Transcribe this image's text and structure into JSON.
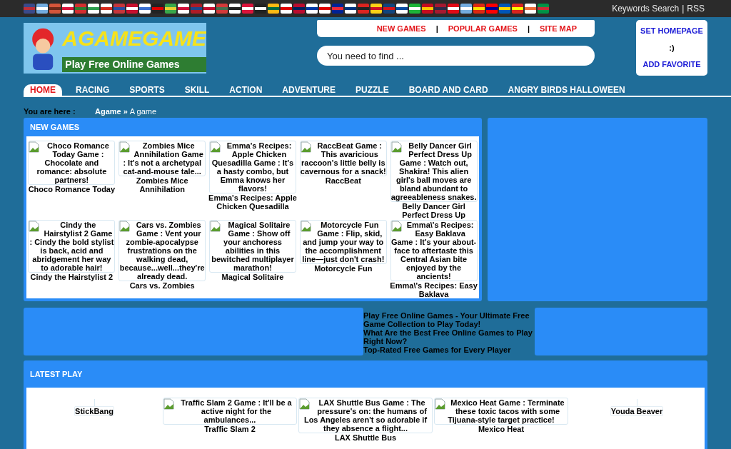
{
  "top_bar": {
    "links": [
      "Keywords Search",
      "RSS"
    ],
    "separator": "|"
  },
  "logo": {
    "name": "AGAMEGAME",
    "tagline": "Play Free Online Games"
  },
  "nav_links": {
    "items": [
      "NEW GAMES",
      "POPULAR GAMES",
      "SITE MAP"
    ],
    "separator": "|"
  },
  "search": {
    "placeholder": "You need to find ..."
  },
  "side_box": [
    {
      "kind": "link",
      "text": "SET HOMEPAGE"
    },
    {
      "kind": "text",
      "text": ":)"
    },
    {
      "kind": "link",
      "text": "ADD FAVORITE"
    }
  ],
  "menu": [
    {
      "label": "HOME",
      "selected": true
    },
    {
      "label": "RACING",
      "selected": false
    },
    {
      "label": "SPORTS",
      "selected": false
    },
    {
      "label": "SKILL",
      "selected": false
    },
    {
      "label": "ACTION",
      "selected": false
    },
    {
      "label": "ADVENTURE",
      "selected": false
    },
    {
      "label": "PUZZLE",
      "selected": false
    },
    {
      "label": "BOARD AND CARD",
      "selected": false
    },
    {
      "label": "ANGRY BIRDS HALLOWEEN",
      "selected": false
    }
  ],
  "breadcrumb": {
    "label": "You are here :",
    "items": [
      "Agame",
      "A game"
    ],
    "separator": "»"
  },
  "new_games": {
    "title": "NEW GAMES",
    "games": [
      {
        "alt": "Choco Romance Today Game : Chocolate and romance: absolute partners!",
        "title": "Choco Romance Today"
      },
      {
        "alt": "Zombies Mice Annihilation Game : It's not a archetypal cat-and-mouse tale...",
        "title": "Zombies Mice Annihilation"
      },
      {
        "alt": "Emma's Recipes: Apple Chicken Quesadilla Game : It's a hasty combo, but Emma knows her flavors!",
        "title": "Emma's Recipes: Apple Chicken Quesadilla"
      },
      {
        "alt": "RaccBeat Game : This avaricious raccoon's little belly is cavernous for a snack!",
        "title": "RaccBeat"
      },
      {
        "alt": "Belly Dancer Girl Perfect Dress Up Game : Watch out, Shakira! This alien girl's ball moves are bland abundant to agreeableness snakes.",
        "title": "Belly Dancer Girl Perfect Dress Up"
      },
      {
        "alt": "Cindy the Hairstylist 2 Game : Cindy the bold stylist is back, acid and abridgement her way to adorable hair!",
        "title": "Cindy the Hairstylist 2"
      },
      {
        "alt": "Cars vs. Zombies Game : Vent your zombie-apocalypse frustrations on the walking dead, because...well...they're already dead.",
        "title": "Cars vs. Zombies"
      },
      {
        "alt": "Magical Solitaire Game : Show off your anchoress abilities in this bewitched multiplayer marathon!",
        "title": "Magical Solitaire"
      },
      {
        "alt": "Motorcycle Fun Game : Flip, skid, and jump your way to the accomplishment line—just don't crash!",
        "title": "Motorcycle Fun"
      },
      {
        "alt": "Emma\\'s Recipes: Easy Baklava Game : It's your about-face to aftertaste this Central Asian bite enjoyed by the ancients!",
        "title": "Emma\\'s Recipes: Easy Baklava"
      }
    ]
  },
  "article_links": [
    "Play Free Online Games - Your Ultimate Free Game Collection to Play Today!",
    "What Are the Best Free Online Games to Play Right Now?",
    "Top-Rated Free Games for Every Player"
  ],
  "latest_play": {
    "title": "LATEST PLAY",
    "games": [
      {
        "kind": "small",
        "alt": "StickBang"
      },
      {
        "kind": "card",
        "alt": "Traffic Slam 2 Game : It'll be a active night for the ambulances...",
        "title": "Traffic Slam 2"
      },
      {
        "kind": "card",
        "alt": "LAX Shuttle Bus Game : The pressure's on: the humans of Los Angeles aren't so adorable if they absence a flight...",
        "title": "LAX Shuttle Bus"
      },
      {
        "kind": "card",
        "alt": "Mexico Heat Game : Terminate these toxic tacos with some Tijuana-style target practice!",
        "title": "Mexico Heat"
      },
      {
        "kind": "small",
        "alt": "Youda Beaver"
      }
    ]
  }
}
